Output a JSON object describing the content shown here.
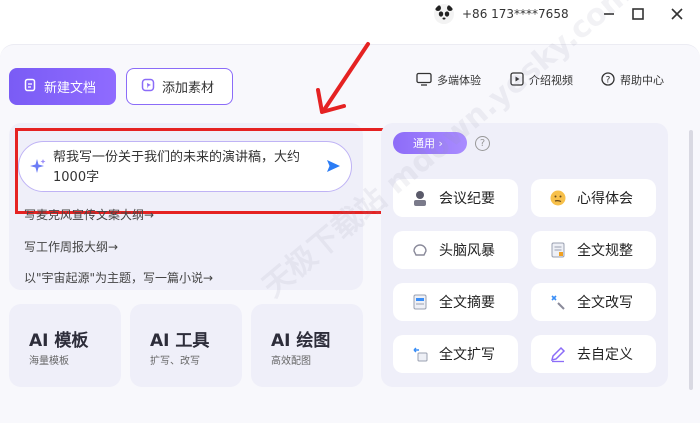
{
  "titlebar": {
    "phone": "+86 173****7658"
  },
  "toolbar": {
    "new_doc": "新建文档",
    "add_material": "添加素材",
    "multi_device": "多端体验",
    "intro_video": "介绍视频",
    "help_center": "帮助中心"
  },
  "prompt": {
    "text": "帮我写一份关于我们的未来的演讲稿，大约1000字"
  },
  "suggestions": [
    "写麦克风宣传文案大纲→",
    "写工作周报大纲→",
    "以\"宇宙起源\"为主题，写一篇小说→"
  ],
  "tools": [
    {
      "title": "AI 模板",
      "sub": "海量模板"
    },
    {
      "title": "AI 工具",
      "sub": "扩写、改写"
    },
    {
      "title": "AI 绘图",
      "sub": "高效配图"
    }
  ],
  "templates": {
    "category": "通用 ›",
    "items": [
      {
        "label": "会议纪要",
        "icon": "meeting-icon"
      },
      {
        "label": "心得体会",
        "icon": "thinking-face-icon"
      },
      {
        "label": "头脑风暴",
        "icon": "brainstorm-icon"
      },
      {
        "label": "全文规整",
        "icon": "document-format-icon"
      },
      {
        "label": "全文摘要",
        "icon": "summary-icon"
      },
      {
        "label": "全文改写",
        "icon": "rewrite-icon"
      },
      {
        "label": "全文扩写",
        "icon": "expand-icon"
      },
      {
        "label": "去自定义",
        "icon": "pencil-icon"
      }
    ]
  },
  "watermark": "天极下载站 mdown.yesky.com",
  "colors": {
    "accent": "#8b6cf8",
    "annotation_red": "#e52222"
  }
}
